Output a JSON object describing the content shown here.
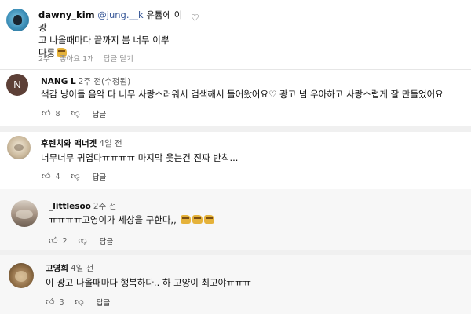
{
  "ig_comment": {
    "username": "dawny_kim",
    "mention": "@jung.__k",
    "text_line1": "유튭에 이 광",
    "text_line2": "고 나올때마다 끝까지 봄 너무 이뿌",
    "text_line3": "다룽",
    "time": "2주",
    "likes": "좋아요 1개",
    "reply": "답글 달기",
    "heart_icon": "heart-outline-icon"
  },
  "comments": [
    {
      "avatar_letter": "N",
      "username": "NANG L",
      "time": "2주 전(수정됨)",
      "text": "색감 냥이들 음악 다 너무 사랑스러워서 검색해서 들어왔어요♡ 광고 넘 우아하고 사랑스럽게 잘 만들었어요",
      "likes": "8",
      "reply_label": "답글"
    },
    {
      "username": "후렌치와 맥너겟",
      "time": "4일 전",
      "text": "너무너무 귀엽다ㅠㅠㅠㅠ 마지막 웃는건 진짜 반칙...",
      "likes": "4",
      "reply_label": "답글"
    },
    {
      "username": "_littlesoo",
      "time": "2주 전",
      "text": "ㅠㅠㅠㅠ고영이가 세상을 구한다,,",
      "likes": "2",
      "reply_label": "답글"
    },
    {
      "username": "고영희",
      "time": "4일 전",
      "text": "이 광고 나올때마다 행복하다.. 하 고양이 최고야ㅠㅠㅠ",
      "likes": "3",
      "reply_label": "답글"
    }
  ],
  "colors": {
    "mention": "#385898",
    "meta_gray": "#8e8e8e",
    "nang_avatar": "#5d4037",
    "highlight_bg": "#f7f7f7"
  }
}
